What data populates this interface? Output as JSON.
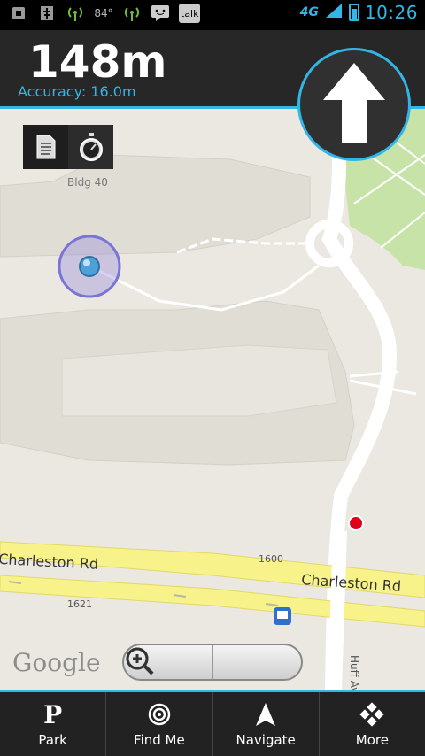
{
  "status_bar": {
    "temperature": "84°",
    "talk": "talk",
    "network": "4G",
    "time": "10:26"
  },
  "header": {
    "distance": "148m",
    "accuracy": "Accuracy: 16.0m"
  },
  "map": {
    "labels": {
      "bldg": "Bldg 40",
      "road1": "Charleston Rd",
      "road2": "Charleston Rd",
      "num1600": "1600",
      "num1621": "1621",
      "huff": "Huff Av"
    },
    "logo": "Google"
  },
  "colors": {
    "accent": "#33b5e5",
    "header_bg": "#272727",
    "map_bg": "#ebe8e1",
    "road": "#f7f28a",
    "park": "#c7e3a8",
    "marker": "#e0001a"
  },
  "bottom_nav": {
    "items": [
      {
        "label": "Park",
        "icon": "parking-icon"
      },
      {
        "label": "Find Me",
        "icon": "target-icon"
      },
      {
        "label": "Navigate",
        "icon": "navigate-icon"
      },
      {
        "label": "More",
        "icon": "more-icon"
      }
    ]
  }
}
